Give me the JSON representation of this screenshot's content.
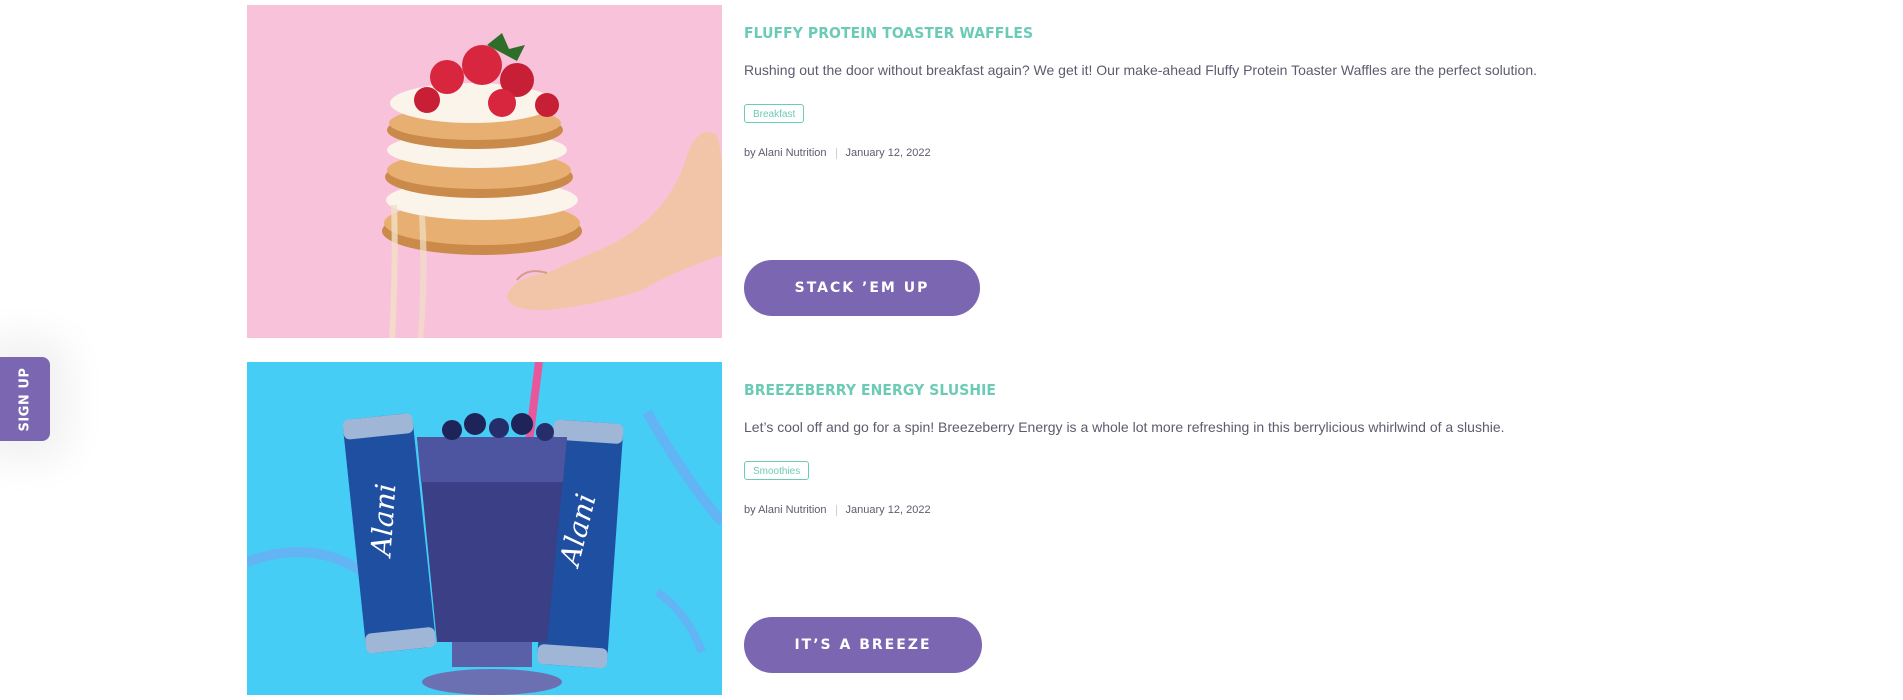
{
  "signup": {
    "label": "SIGN UP"
  },
  "articles": [
    {
      "title": "FLUFFY PROTEIN TOASTER WAFFLES",
      "description": "Rushing out the door without breakfast again? We get it! Our make-ahead Fluffy Protein Toaster Waffles are the perfect solution.",
      "tag": "Breakfast",
      "author": "by Alani Nutrition",
      "date": "January 12, 2022",
      "cta": "STACK ’EM UP",
      "image_bg": "#f8c3da"
    },
    {
      "title": "BREEZEBERRY ENERGY SLUSHIE",
      "description": "Let’s cool off and go for a spin! Breezeberry Energy is a whole lot more refreshing in this berrylicious whirlwind of a slushie.",
      "tag": "Smoothies",
      "author": "by Alani Nutrition",
      "date": "January 12, 2022",
      "cta": "IT’S A BREEZE",
      "image_bg": "#45cdf5",
      "can_text": "Alani"
    }
  ],
  "colors": {
    "accent": "#7b66b2",
    "teal": "#6ccbb7",
    "text": "#5c5c6e"
  }
}
